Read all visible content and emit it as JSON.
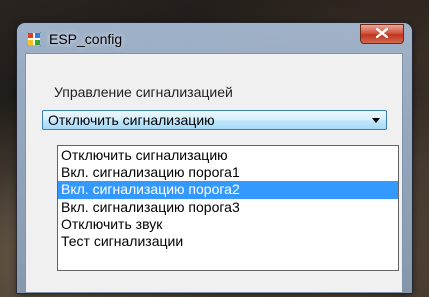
{
  "window": {
    "title": "ESP_config",
    "close_symbol": "x"
  },
  "alarm_control": {
    "label": "Управление сигнализацией",
    "selected_value": "Отключить сигнализацию",
    "options": [
      "Отключить сигнализацию",
      "Вкл. сигнализацию порога1",
      "Вкл. сигнализацию порога2",
      "Вкл. сигнализацию порога3",
      "Отключить звук",
      "Тест сигнализации"
    ],
    "highlighted_option": "Вкл. сигнализацию порога2"
  },
  "icons": {
    "app": "app-icon",
    "close": "close-icon",
    "dropdown": "chevron-down-icon"
  },
  "colors": {
    "highlight": "#3399ff",
    "close_button": "#c7482f"
  }
}
